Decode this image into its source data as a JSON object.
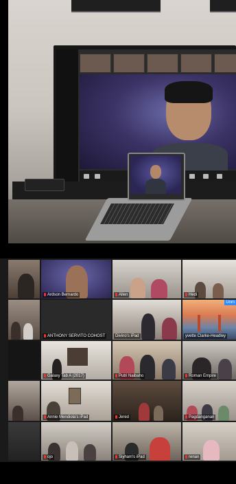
{
  "zoom_gallery": {
    "tiles": [
      {
        "name": ""
      },
      {
        "name": "Ardson Bernardo"
      },
      {
        "name": "Allen"
      },
      {
        "name": "Hedi"
      },
      {
        "name": ""
      },
      {
        "name": "ANTHONY SERVITO COHOST"
      },
      {
        "name": "Divino's iPad"
      },
      {
        "name": "yvette Clarke-Headley"
      },
      {
        "name": ""
      },
      {
        "name": "Galaxy Tab A (2017)"
      },
      {
        "name": "Putri Naibaho"
      },
      {
        "name": "Roman Empire"
      },
      {
        "name": ""
      },
      {
        "name": "Annie Mendiola's iPad"
      },
      {
        "name": "Jered"
      },
      {
        "name": "Pagdanganan"
      },
      {
        "name": ""
      },
      {
        "name": "ojo"
      },
      {
        "name": "Siyham's iPad"
      },
      {
        "name": "renan"
      }
    ],
    "badge": "Unm"
  },
  "colors": {
    "active_outline": "#e8e26a",
    "badge": "#2d8cff",
    "muted_mic": "#e33333"
  }
}
